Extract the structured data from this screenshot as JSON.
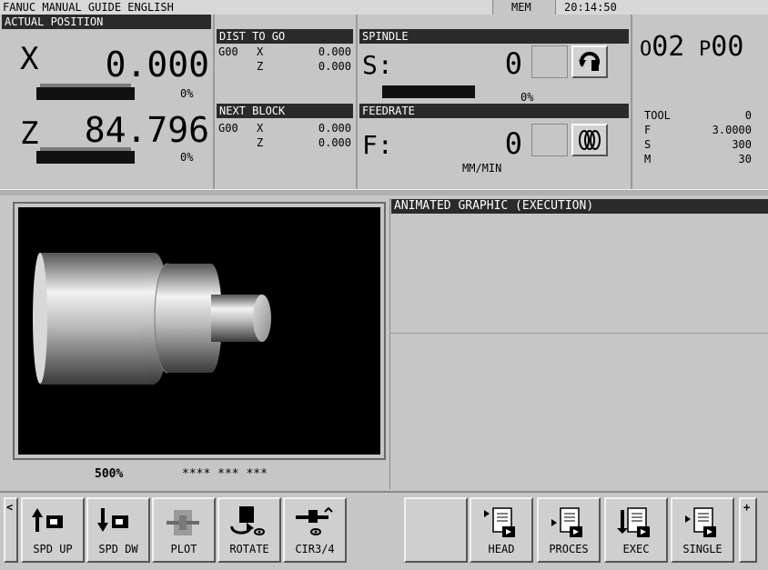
{
  "title_bar": {
    "app_title": "FANUC MANUAL GUIDE ENGLISH",
    "mode": "MEM",
    "clock": "20:14:50"
  },
  "actual_position": {
    "header": "ACTUAL POSITION",
    "x_axis": "X",
    "x_value": "0.000",
    "x_load": "0%",
    "z_axis": "Z",
    "z_value": "84.796",
    "z_load": "0%"
  },
  "dist_to_go": {
    "header": "DIST TO GO",
    "g_code": "G00",
    "x_label": "X",
    "x_value": "0.000",
    "z_label": "Z",
    "z_value": "0.000"
  },
  "next_block": {
    "header": "NEXT BLOCK",
    "g_code": "G00",
    "x_label": "X",
    "x_value": "0.000",
    "z_label": "Z",
    "z_value": "0.000"
  },
  "spindle": {
    "header": "SPINDLE",
    "label": "S:",
    "value": "0",
    "load": "0%"
  },
  "feedrate": {
    "header": "FEEDRATE",
    "label": "F:",
    "value": "0",
    "unit": "MM/MIN"
  },
  "program": {
    "o_label": "O",
    "o_number": "02",
    "p_label": "P",
    "p_number": "00",
    "tool_label": "TOOL",
    "tool_value": "0",
    "f_label": "F",
    "f_value": "3.0000",
    "s_label": "S",
    "s_value": "300",
    "m_label": "M",
    "m_value": "30"
  },
  "graphic": {
    "zoom": "500%",
    "coords": "**** *** ***"
  },
  "animated_header": "ANIMATED GRAPHIC (EXECUTION)",
  "softkeys_left": [
    {
      "label": "SPD UP"
    },
    {
      "label": "SPD DW"
    },
    {
      "label": "PLOT"
    },
    {
      "label": "ROTATE"
    },
    {
      "label": "CIR3/4"
    }
  ],
  "softkeys_right": [
    {
      "label": ""
    },
    {
      "label": "HEAD"
    },
    {
      "label": "PROCES"
    },
    {
      "label": "EXEC"
    },
    {
      "label": "SINGLE"
    }
  ],
  "nav": {
    "left_arrow": "<",
    "right_plus": "+"
  }
}
